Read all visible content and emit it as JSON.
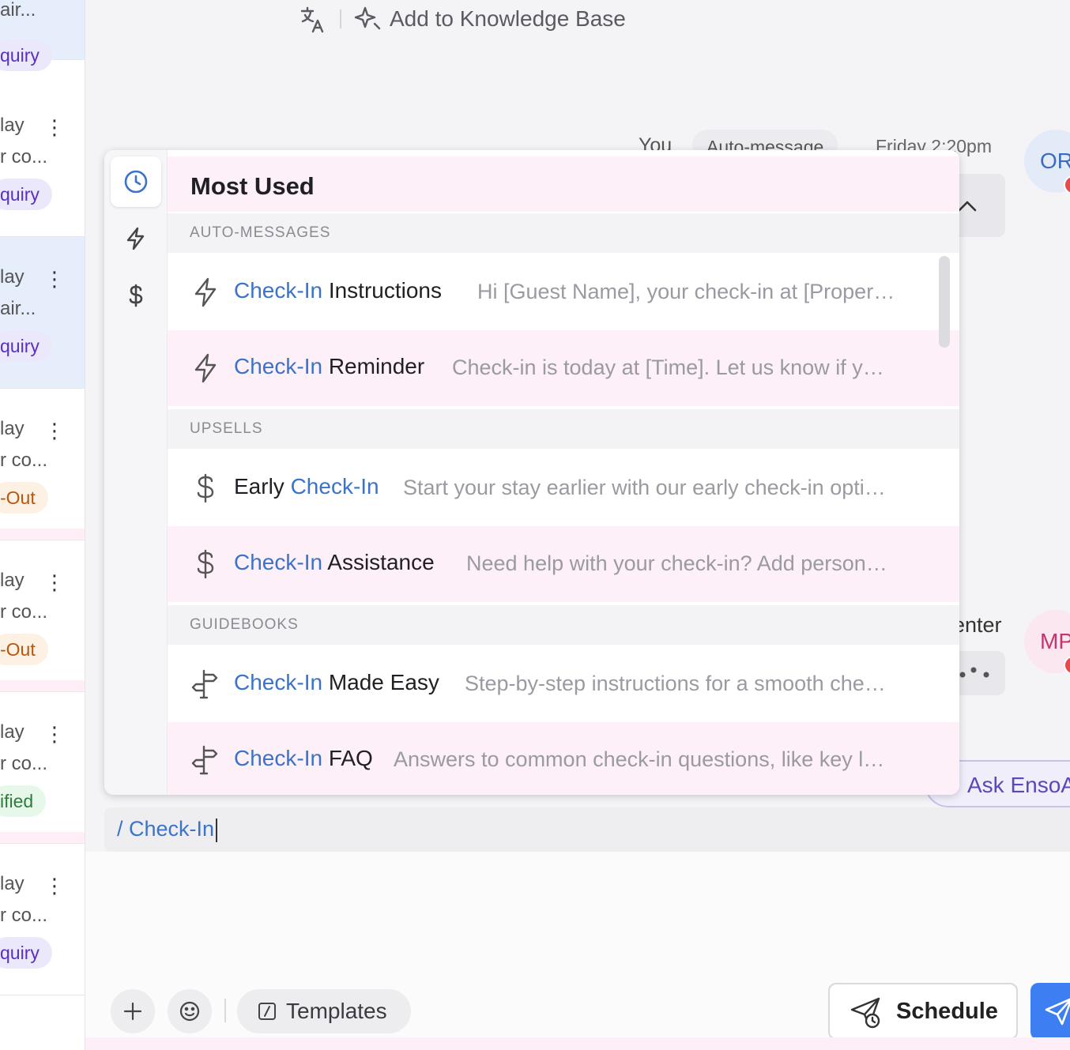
{
  "conversations": [
    {
      "line1": "air...",
      "line2": "",
      "tag": "quiry",
      "tag_type": "inquiry",
      "selected": true
    },
    {
      "line1": "lay",
      "line2": "r co...",
      "tag": "quiry",
      "tag_type": "inquiry",
      "selected": false
    },
    {
      "line1": "lay",
      "line2": "air...",
      "tag": "quiry",
      "tag_type": "inquiry",
      "selected": true
    },
    {
      "line1": "lay",
      "line2": "r co...",
      "tag": "-Out",
      "tag_type": "checkout",
      "selected": false
    },
    {
      "line1": "lay",
      "line2": "r co...",
      "tag": "-Out",
      "tag_type": "checkout",
      "selected": false
    },
    {
      "line1": "lay",
      "line2": "r co...",
      "tag": "ified",
      "tag_type": "verified",
      "selected": false
    },
    {
      "line1": "lay",
      "line2": "r co...",
      "tag": "quiry",
      "tag_type": "inquiry",
      "selected": false
    }
  ],
  "topbar": {
    "translate_icon": "translate-icon",
    "kb_label": "Add to Knowledge Base"
  },
  "thread": {
    "sender": "You",
    "badge": "Auto-message",
    "time": "Friday 2:20pm",
    "avatar_or": "OR",
    "avatar_mp": "MP",
    "center_fragment": "enter",
    "ask_enso": "Ask EnsoAI"
  },
  "popup": {
    "rail": [
      {
        "name": "rail-clock-icon",
        "active": true
      },
      {
        "name": "rail-bolt-icon",
        "active": false
      },
      {
        "name": "rail-dollar-icon",
        "active": false
      }
    ],
    "header": "Most Used",
    "sections": {
      "auto_messages": "AUTO-MESSAGES",
      "upsells": "UPSELLS",
      "guidebooks": "GUIDEBOOKS"
    },
    "items": [
      {
        "icon": "bolt",
        "prefix": "",
        "highlight": "Check-In",
        "suffix": " Instructions",
        "preview": "Hi [Guest Name], your check-in at [Proper…"
      },
      {
        "icon": "bolt",
        "prefix": "",
        "highlight": "Check-In",
        "suffix": " Reminder",
        "preview": "Check-in is today at [Time]. Let us know if y…"
      },
      {
        "icon": "dollar",
        "prefix": "Early ",
        "highlight": "Check-In",
        "suffix": "",
        "preview": "Start your stay earlier with our early check-in opti…"
      },
      {
        "icon": "dollar",
        "prefix": "",
        "highlight": "Check-In",
        "suffix": " Assistance",
        "preview": "Need help with your check-in? Add person…"
      },
      {
        "icon": "signpost",
        "prefix": "",
        "highlight": "Check-In",
        "suffix": " Made Easy",
        "preview": "Step-by-step instructions for a smooth che…"
      },
      {
        "icon": "signpost",
        "prefix": "",
        "highlight": "Check-In",
        "suffix": " FAQ",
        "preview": "Answers to common check-in questions, like key l…"
      }
    ]
  },
  "composer": {
    "input_value": "/ Check-In",
    "templates_label": "Templates",
    "schedule_label": "Schedule"
  },
  "colors": {
    "accent_blue": "#3a73c9",
    "send_blue": "#3d7ff2",
    "highlight_pink": "#fdf0f8"
  }
}
